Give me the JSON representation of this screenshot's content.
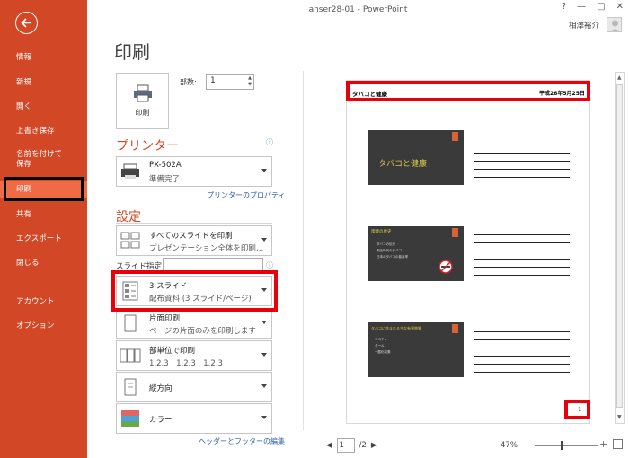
{
  "window": {
    "title": "anser28-01 - PowerPoint",
    "controls": [
      "?",
      "—",
      "□",
      "✕"
    ],
    "user_name": "相澤裕介"
  },
  "nav": {
    "items": [
      {
        "label": "情報"
      },
      {
        "label": "新規"
      },
      {
        "label": "開く"
      },
      {
        "label": "上書き保存"
      },
      {
        "label": "名前を付けて保存"
      },
      {
        "label": "印刷",
        "active": true
      },
      {
        "label": "共有"
      },
      {
        "label": "エクスポート"
      },
      {
        "label": "閉じる"
      },
      {
        "label": "アカウント"
      },
      {
        "label": "オプション"
      }
    ],
    "accent_color": "#d24726"
  },
  "page_title": "印刷",
  "print_button_label": "印刷",
  "copies": {
    "label": "部数:",
    "value": "1"
  },
  "printer": {
    "section_title": "プリンター",
    "name": "PX-502A",
    "status": "準備完了",
    "properties_link": "プリンターのプロパティ"
  },
  "settings": {
    "section_title": "設定",
    "range": {
      "line1": "すべてのスライドを印刷",
      "line2": "プレゼンテーション全体を印刷…"
    },
    "slides_label": "スライド指定:",
    "slides_value": "",
    "layout": {
      "line1": "3 スライド",
      "line2": "配布資料 (3 スライド/ページ)"
    },
    "sides": {
      "line1": "片面印刷",
      "line2": "ページの片面のみを印刷します"
    },
    "collate": {
      "line1": "部単位で印刷",
      "line2": "1,2,3　1,2,3　1,2,3"
    },
    "orientation": "縦方向",
    "color": "カラー",
    "header_footer_link": "ヘッダーとフッターの編集"
  },
  "preview": {
    "header_left": "タバコと健康",
    "header_right": "平成26年5月25日",
    "slides": [
      {
        "title": "タバコと健康",
        "kind": "title"
      },
      {
        "title": "喫煙の歴史",
        "bullets": [
          "タバコの伝来",
          "明治時代のタバコ",
          "日本のタバコの普及率"
        ],
        "kind": "content"
      },
      {
        "title": "タバコに含まれる主な有害物質",
        "bullets": [
          "ニコチン",
          "タール",
          "一酸化炭素"
        ],
        "kind": "content"
      }
    ],
    "page_number": "1"
  },
  "pager": {
    "current": "1",
    "total": "/2"
  },
  "zoom": "47%"
}
